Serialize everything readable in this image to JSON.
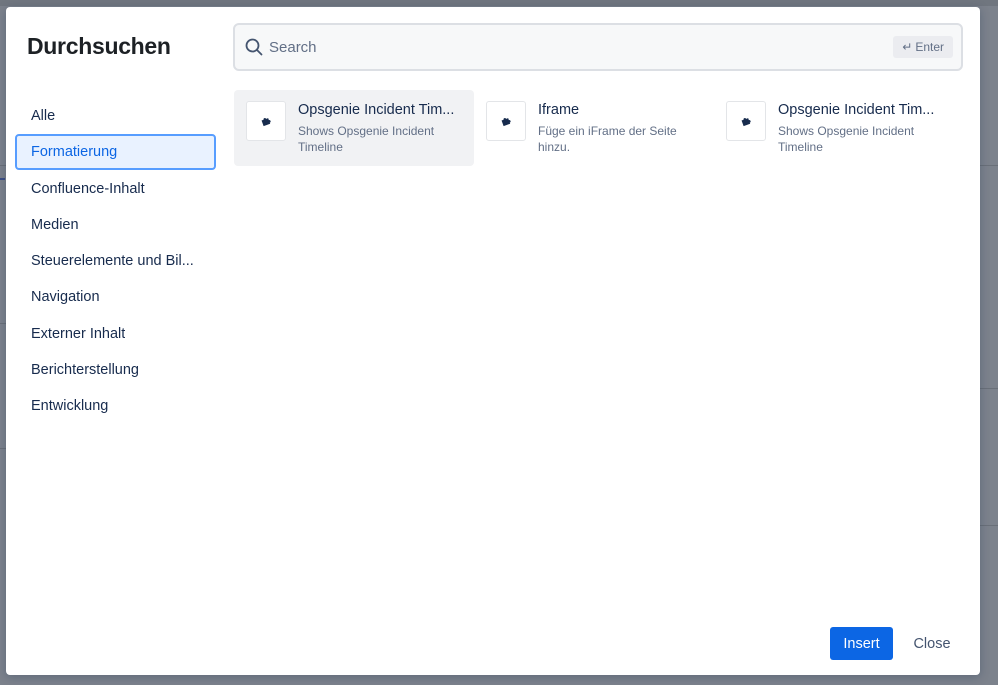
{
  "dialog": {
    "title": "Durchsuchen"
  },
  "search": {
    "placeholder": "Search",
    "enter_hint": "Enter"
  },
  "categories": [
    {
      "label": "Alle",
      "active": false
    },
    {
      "label": "Formatierung",
      "active": true
    },
    {
      "label": "Confluence-Inhalt",
      "active": false
    },
    {
      "label": "Medien",
      "active": false
    },
    {
      "label": "Steuerelemente und Bil...",
      "active": false
    },
    {
      "label": "Navigation",
      "active": false
    },
    {
      "label": "Externer Inhalt",
      "active": false
    },
    {
      "label": "Berichterstellung",
      "active": false
    },
    {
      "label": "Entwicklung",
      "active": false
    }
  ],
  "results": [
    {
      "title": "Opsgenie Incident Tim...",
      "description": "Shows Opsgenie Incident Timeline",
      "icon": "puzzle-piece-icon"
    },
    {
      "title": "Iframe",
      "description": "Füge ein iFrame der Seite hinzu.",
      "icon": "puzzle-piece-icon"
    },
    {
      "title": "Opsgenie Incident Tim...",
      "description": "Shows Opsgenie Incident Timeline",
      "icon": "puzzle-piece-icon"
    }
  ],
  "footer": {
    "insert_label": "Insert",
    "close_label": "Close"
  },
  "colors": {
    "primary": "#0c66e4",
    "active_bg": "#e9f2ff",
    "active_border": "#579dff",
    "hover_bg": "#f1f2f4"
  }
}
